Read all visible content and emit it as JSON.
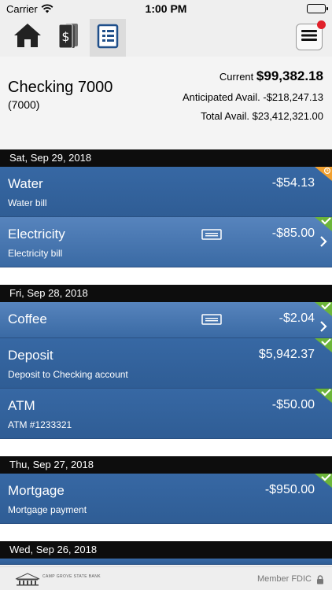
{
  "status_bar": {
    "carrier": "Carrier",
    "time": "1:00 PM"
  },
  "nav": {
    "tabs": [
      {
        "icon": "home-icon",
        "active": false
      },
      {
        "icon": "money-cards-icon",
        "active": false
      },
      {
        "icon": "ledger-icon",
        "active": true
      }
    ],
    "menu_icon": "hamburger-menu-icon"
  },
  "account": {
    "name": "Checking 7000",
    "number": "(7000)",
    "current_label": "Current",
    "current_value": "$99,382.18",
    "anticipated_label": "Anticipated Avail.",
    "anticipated_value": "-$218,247.13",
    "total_label": "Total Avail.",
    "total_value": "$23,412,321.00"
  },
  "days": [
    {
      "date": "Sat, Sep 29, 2018",
      "transactions": [
        {
          "title": "Water",
          "subtitle": "Water bill",
          "amount": "-$54.13",
          "status": "pending",
          "has_note": false,
          "has_chevron": false,
          "selected": false
        },
        {
          "title": "Electricity",
          "subtitle": "Electricity bill",
          "amount": "-$85.00",
          "status": "cleared",
          "has_note": true,
          "has_chevron": true,
          "selected": true
        }
      ]
    },
    {
      "date": "Fri, Sep 28, 2018",
      "transactions": [
        {
          "title": "Coffee",
          "subtitle": "",
          "amount": "-$2.04",
          "status": "cleared",
          "has_note": true,
          "has_chevron": true,
          "selected": true
        },
        {
          "title": "Deposit",
          "subtitle": "Deposit to Checking account",
          "amount": "$5,942.37",
          "status": "cleared",
          "has_note": false,
          "has_chevron": false,
          "selected": false
        },
        {
          "title": "ATM",
          "subtitle": "ATM #1233321",
          "amount": "-$50.00",
          "status": "cleared",
          "has_note": false,
          "has_chevron": false,
          "selected": false
        }
      ]
    },
    {
      "date": "Thu, Sep 27, 2018",
      "transactions": [
        {
          "title": "Mortgage",
          "subtitle": "Mortgage payment",
          "amount": "-$950.00",
          "status": "cleared",
          "has_note": false,
          "has_chevron": false,
          "selected": false
        }
      ]
    },
    {
      "date": "Wed, Sep 26, 2018",
      "transactions": []
    }
  ],
  "footer": {
    "bank_name": "CAMP GROVE STATE BANK",
    "member_text": "Member FDIC"
  },
  "colors": {
    "row_blue": "#2f5d95",
    "row_selected": "#4a78b2",
    "cleared_green": "#6cb53a",
    "pending_orange": "#f0a030",
    "header_black": "#0d0d0d"
  }
}
